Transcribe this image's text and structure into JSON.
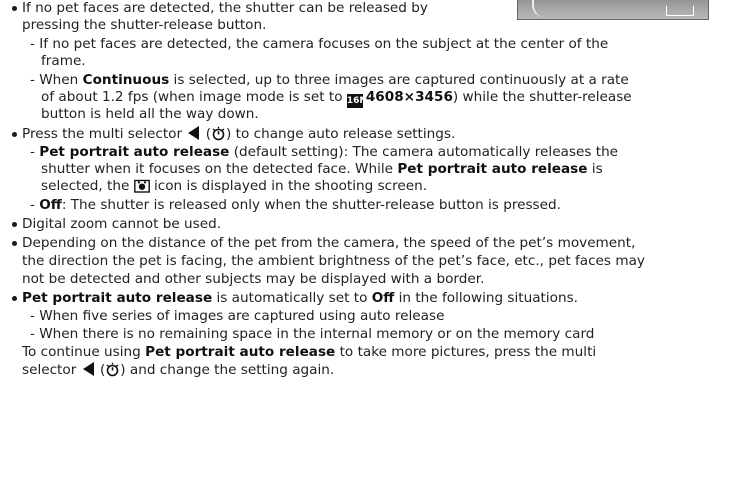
{
  "lines": {
    "b1_l1": "If no pet faces are detected, the shutter can be released by",
    "b1_l2": "pressing the shutter-release button.",
    "d1_l1": "If no pet faces are detected, the camera focuses on the subject at the center of the",
    "d1_l2": "frame.",
    "d2_pre": "When ",
    "d2_bold": "Continuous",
    "d2_post": " is selected, up to three images are captured continuously at a rate",
    "d2_l2_pre": "of about 1.2 fps (when image mode is set to ",
    "d2_l2_mode": "4608×3456",
    "d2_l2_post": ") while the shutter-release",
    "d2_l3": "button is held all the way down.",
    "b2_pre": "Press the multi selector ",
    "b2_post": " to change auto release settings.",
    "d3_bold": "Pet portrait auto release",
    "d3_post": " (default setting): The camera automatically releases the",
    "d3_l2_pre": "shutter when it focuses on the detected face. While ",
    "d3_l2_bold": "Pet portrait auto release",
    "d3_l2_post": " is",
    "d3_l3_pre": "selected, the ",
    "d3_l3_post": " icon is displayed in the shooting screen.",
    "d4_bold": "Off",
    "d4_post": ": The shutter is released only when the shutter-release button is pressed.",
    "b3": "Digital zoom cannot be used.",
    "b4_l1": "Depending on the distance of the pet from the camera, the speed of the pet’s movement,",
    "b4_l2": "the direction the pet is facing, the ambient brightness of the pet’s face, etc., pet faces may",
    "b4_l3": "not be detected and other subjects may be displayed with a border.",
    "b5_bold": "Pet portrait auto release",
    "b5_mid": " is automatically set to ",
    "b5_bold2": "Off",
    "b5_post": " in the following situations.",
    "d5": "When five series of images are captured using auto release",
    "d6": "When there is no remaining space in the internal memory or on the memory card",
    "c1_pre": "To continue using ",
    "c1_bold": "Pet portrait auto release",
    "c1_post": " to take more pictures, press the multi",
    "c2_pre": "selector ",
    "c2_post": " and change the setting again."
  },
  "icons": {
    "imgmode_glyph": "16M"
  }
}
